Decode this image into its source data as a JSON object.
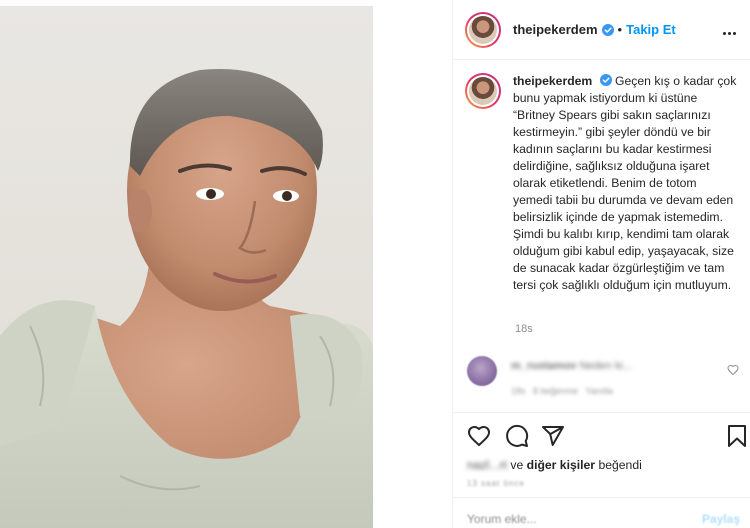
{
  "post": {
    "username": "theipekerdem",
    "separator": "•",
    "follow_label": "Takip Et",
    "caption": "Geçen kış o kadar çok bunu yapmak istiyordum ki üstüne “Britney Spears gibi sakın saçlarınızı kestirmeyin.” gibi şeyler döndü ve bir kadının saçlarını bu kadar kestirmesi delirdiğine, sağlıksız olduğuna işaret olarak etiketlendi. Benim de totom yemedi tabii bu durumda ve devam eden belirsizlik içinde de yapmak istemedim. Şimdi bu kalıbı kırıp, kendimi tam olarak olduğum gibi kabul edip, yaşayacak, size de sunacak kadar özgürleştiğim ve tam tersi çok sağlıklı olduğum için mutluyum.",
    "time_ago": "18s"
  },
  "comment": {
    "username": "m_rustamov",
    "text": "Neden ki...",
    "meta_time": "18s",
    "meta_likes": "8 beğenme",
    "meta_reply": "Yanıtla"
  },
  "likes": {
    "first_liker": "nazl...rt",
    "connector": "ve",
    "others": "diğer kişiler",
    "suffix": "beğendi"
  },
  "date_text": "13 saat önce",
  "comment_box": {
    "placeholder": "Yorum ekle...",
    "post_label": "Paylaş"
  },
  "icons": {
    "verified": "verified-badge-icon",
    "more": "more-options-icon",
    "like": "heart-icon",
    "comment": "comment-bubble-icon",
    "share": "paper-plane-icon",
    "save": "bookmark-icon"
  },
  "colors": {
    "accent": "#0095f6",
    "verified": "#3897f0",
    "text": "#262626",
    "muted": "#8e8e8e"
  }
}
